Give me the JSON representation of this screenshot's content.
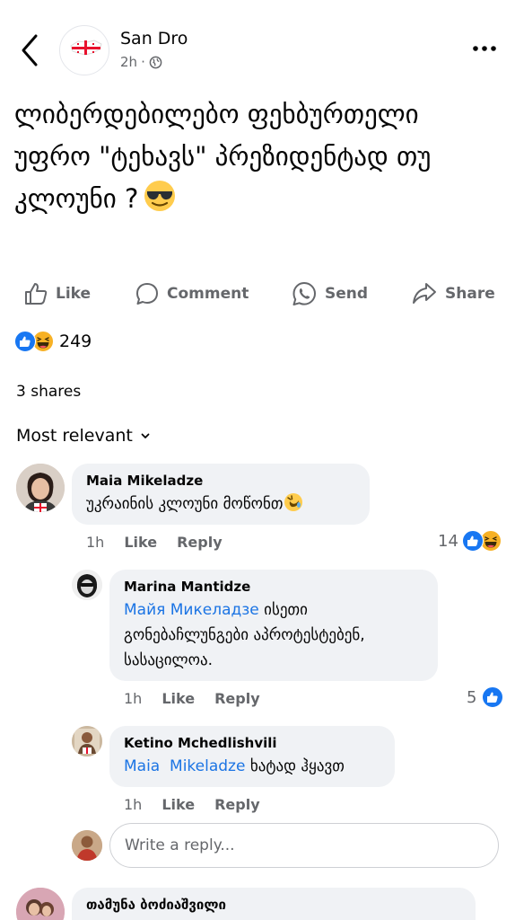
{
  "header": {
    "author": "San Dro",
    "time": "2h",
    "separator": "·"
  },
  "post": {
    "text": "ლიბერდებილებო ფეხბურთელი უფრო \"ტეხავს\" პრეზიდენტად თუ კლოუნი ?",
    "emoji_icon": "smiling-face-with-sunglasses-emoji"
  },
  "actions": {
    "like": "Like",
    "comment": "Comment",
    "send": "Send",
    "share": "Share"
  },
  "stats": {
    "reaction_count": "249",
    "reaction_icons": [
      "like-reaction-icon",
      "haha-reaction-icon"
    ],
    "shares": "3 shares"
  },
  "sort": {
    "label": "Most relevant"
  },
  "comments": [
    {
      "name": "Maia  Mikeladze",
      "text": "უკრაინის კლოუნი მოწონთ",
      "time": "1h",
      "like": "Like",
      "reply": "Reply",
      "reactions": "14",
      "reaction_icons": [
        "like-reaction-icon",
        "haha-reaction-icon"
      ]
    },
    {
      "name": "Marina Mantidze",
      "mention": "Майя Микеладзе",
      "text": "ისეთი გონებაჩლუნგები აპროტესტებენ, სასაცილოა.",
      "time": "1h",
      "like": "Like",
      "reply": "Reply",
      "reactions": "5",
      "reaction_icons": [
        "like-reaction-icon"
      ]
    },
    {
      "name": "Ketino Mchedlishvili",
      "mention": "Maia  Mikeladze",
      "text": "ხატად ჰყავთ",
      "time": "1h",
      "like": "Like",
      "reply": "Reply"
    },
    {
      "name": "თამუნა ბოძიაშვილი"
    }
  ],
  "reply_input": {
    "placeholder": "Write a reply..."
  },
  "colors": {
    "link_blue": "#1b74e4",
    "muted_gray": "#65676b",
    "bubble_bg": "#f0f2f5",
    "like_blue": "#1877f2",
    "haha_yellow": "#f7b125"
  }
}
